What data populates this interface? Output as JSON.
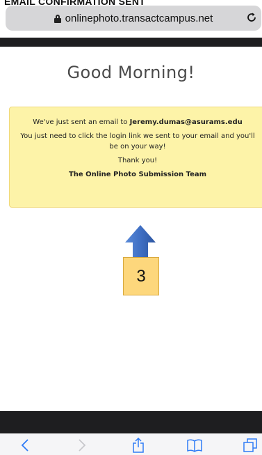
{
  "caption": "EMAIL CONFIRMATION SENT",
  "browser": {
    "url": "onlinephoto.transactcampus.net",
    "icons": {
      "lock": "lock-icon",
      "reload": "reload-icon",
      "back": "back-icon",
      "forward": "forward-icon",
      "share": "share-icon",
      "bookmarks": "bookmarks-icon",
      "tabs": "tabs-icon"
    }
  },
  "page": {
    "greeting": "Good Morning!",
    "notice": {
      "line1_prefix": "We've just sent an email to ",
      "email": "Jeremy.dumas@asurams.edu",
      "line2": "You just need to click the login link we sent to your email and you'll be on your way!",
      "thanks": "Thank you!",
      "team": "The Online Photo Submission Team"
    }
  },
  "annotation": {
    "step_number": "3",
    "colors": {
      "arrow": "#3f6fc4",
      "box_fill": "#fdd77c",
      "box_border": "#d9a93d"
    }
  },
  "colors": {
    "notice_bg": "#fdf3a8",
    "bar_dark": "#1e1e20",
    "toolbar_icons": "#2f7cf6"
  }
}
